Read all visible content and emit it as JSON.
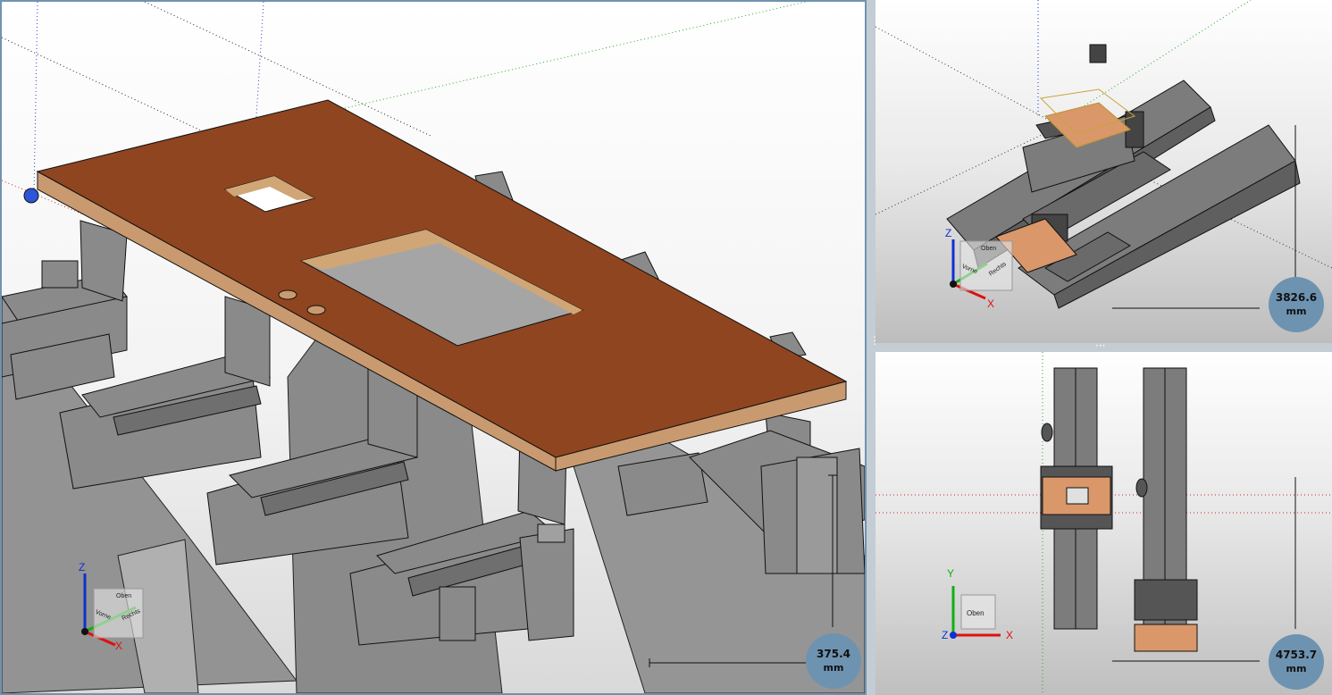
{
  "viewports": {
    "main": {
      "dimension": {
        "value": "375.4",
        "unit": "mm"
      },
      "view_cube": {
        "front": "Vorne",
        "right": "Rechts",
        "top": "Oben"
      },
      "axes": {
        "x": "X",
        "y": "Y",
        "z": "Z"
      }
    },
    "perspective": {
      "dimension": {
        "value": "3826.6",
        "unit": "mm"
      },
      "view_cube": {
        "front": "Vorne",
        "right": "Rechts",
        "top": "Oben"
      },
      "axes": {
        "x": "X",
        "y": "Y",
        "z": "Z"
      }
    },
    "top": {
      "dimension": {
        "value": "4753.7",
        "unit": "mm"
      },
      "view_cube": {
        "top": "Oben"
      },
      "axes": {
        "x": "X",
        "y": "Y",
        "z": "Z"
      }
    }
  },
  "colors": {
    "plate": "#8f4520",
    "plate_edge": "#c99a6f",
    "rail": "#7c7c7c",
    "accent_border": "#6f93b0",
    "x_axis": "#e01010",
    "y_axis": "#10b010",
    "z_axis": "#1030d0"
  }
}
